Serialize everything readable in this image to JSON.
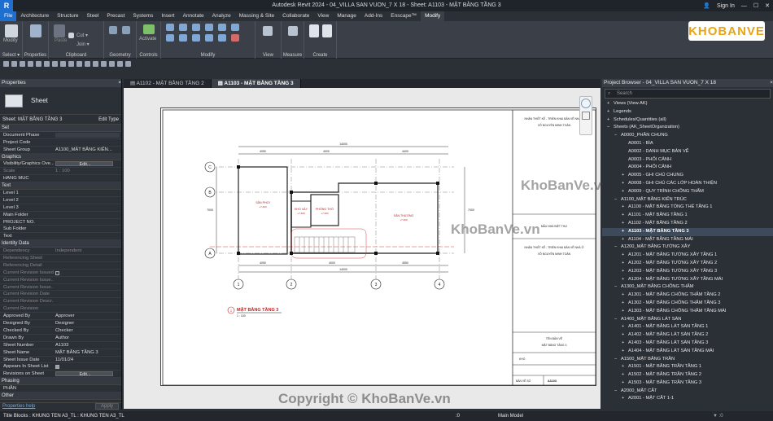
{
  "app": {
    "window_title": "Autodesk Revit 2024 - 04_VILLA SAN VUON_7 X 18 - Sheet: A1103 - MẶT BẰNG TẦNG 3",
    "logo": "R",
    "sign_in": "Sign In"
  },
  "menu": [
    "File",
    "Architecture",
    "Structure",
    "Steel",
    "Precast",
    "Systems",
    "Insert",
    "Annotate",
    "Analyze",
    "Massing & Site",
    "Collaborate",
    "View",
    "Manage",
    "Add-Ins",
    "Enscape™",
    "Modify"
  ],
  "ribbon": {
    "modify": "Modify",
    "select": "Select ▾",
    "properties": "Properties",
    "paste": "Paste",
    "cut": "Cut ▾",
    "join": "Join ▾",
    "clipboard": "Clipboard",
    "geometry": "Geometry",
    "activate": "Activate",
    "controls": "Controls",
    "modify_group": "Modify",
    "view": "View",
    "measure": "Measure",
    "create": "Create"
  },
  "watermark": {
    "logo": "KHOBANVE",
    "text1": "KhoBanVe.vn",
    "text2": "KhoBanVe.vn",
    "copyright": "Copyright © KhoBanVe.vn"
  },
  "properties": {
    "title": "Properties",
    "close": "×",
    "type": "Sheet",
    "selector": "Sheet: MẶT BẰNG TẦNG 3",
    "edit_type": "Edit Type",
    "rows": [
      {
        "cat": "Set"
      },
      {
        "k": "Document Phase",
        "box": true
      },
      {
        "k": "Project Code",
        "v": ""
      },
      {
        "k": "Sheet Group",
        "v": "A1100_MẶT BẰNG KIẾN..."
      },
      {
        "cat": "Graphics"
      },
      {
        "k": "Visibility/Graphics Ove...",
        "btn": "Edit..."
      },
      {
        "k": "Scale",
        "v": "1 : 100",
        "dim": true
      },
      {
        "k": "HANG MUC",
        "v": ""
      },
      {
        "cat": "Text"
      },
      {
        "k": "Level 1",
        "v": ""
      },
      {
        "k": "Level 2",
        "v": ""
      },
      {
        "k": "Level 3",
        "v": ""
      },
      {
        "k": "Main Folder",
        "v": ""
      },
      {
        "k": "PROJECT NO.",
        "v": ""
      },
      {
        "k": "Sub Folder",
        "v": ""
      },
      {
        "k": "Text",
        "v": ""
      },
      {
        "cat": "Identity Data"
      },
      {
        "k": "Dependency",
        "v": "Independent",
        "dim": true
      },
      {
        "k": "Referencing Sheet",
        "v": "",
        "dim": true
      },
      {
        "k": "Referencing Detail",
        "v": "",
        "dim": true
      },
      {
        "k": "Current Revision Issued",
        "cb": false,
        "dim": true
      },
      {
        "k": "Current Revision Issue...",
        "v": "",
        "dim": true
      },
      {
        "k": "Current Revision Issue...",
        "v": "",
        "dim": true
      },
      {
        "k": "Current Revision Date",
        "v": "",
        "dim": true
      },
      {
        "k": "Current Revision Descr...",
        "v": "",
        "dim": true
      },
      {
        "k": "Current Revision",
        "v": "",
        "dim": true
      },
      {
        "k": "Approved By",
        "v": "Approver"
      },
      {
        "k": "Designed By",
        "v": "Designer"
      },
      {
        "k": "Checked By",
        "v": "Checker"
      },
      {
        "k": "Drawn By",
        "v": "Author"
      },
      {
        "k": "Sheet Number",
        "v": "A1103"
      },
      {
        "k": "Sheet Name",
        "v": "MẶT BẰNG TẦNG 3"
      },
      {
        "k": "Sheet Issue Date",
        "v": "11/01/24"
      },
      {
        "k": "Appears In Sheet List",
        "cb": true
      },
      {
        "k": "Revisions on Sheet",
        "btn": "Edit..."
      },
      {
        "cat": "Phasing"
      },
      {
        "k": "PHẦN",
        "v": ""
      },
      {
        "cat": "Other"
      }
    ],
    "help": "Properties help",
    "apply": "Apply"
  },
  "tabs": [
    {
      "label": "A1102 - MẶT BẰNG TẦNG 2",
      "active": false
    },
    {
      "label": "A1103 - MẶT BẰNG TẦNG 3",
      "active": true
    }
  ],
  "drawing": {
    "dim_total": "14000",
    "dims_top": [
      "4050",
      "4000",
      "4400"
    ],
    "dims_bottom": [
      "4050",
      "4000",
      "4550"
    ],
    "side_dim": "7000",
    "rooms": [
      "SÂN PHƠI",
      "KHO XẢY",
      "PHÒNG THỜ",
      "SÂN THƯỢNG"
    ],
    "room_level": "+7.400",
    "grid_cols": [
      "1",
      "2",
      "3",
      "4"
    ],
    "grid_rows": [
      "C",
      "B",
      "A"
    ],
    "view_number": "1",
    "view_title": "MẶT BẰNG TẦNG 3",
    "view_scale": "1 : 100",
    "tb_company": "NHẬN THIẾT KẾ - TRIỂN KHAI BẢN VẼ NHÀ Ở",
    "tb_person": "VÕ NGUYÊN MINH TOÀN",
    "tb_project": "MẪU NHÀ BIỆT THỰ",
    "tb_sheet_label": "TÊN BẢN VẼ",
    "tb_sheet_name": "MẶT BẰNG TẦNG 3",
    "tb_scale": "KHỔ",
    "tb_no_label": "BẢN VẼ SỐ",
    "tb_no": "A1103"
  },
  "browser": {
    "title": "Project Browser - 04_VILLA SAN VUON_7 X 18",
    "close": "×",
    "search": "Search",
    "items": [
      {
        "t": "Views (View AK)",
        "l": 0,
        "exp": "+"
      },
      {
        "t": "Legends",
        "l": 0,
        "exp": "+"
      },
      {
        "t": "Schedules/Quantities (all)",
        "l": 0,
        "exp": "+"
      },
      {
        "t": "Sheets (AK_SheetOrganization)",
        "l": 0,
        "exp": "−"
      },
      {
        "t": "A0000_PHẦN CHUNG",
        "l": 1,
        "exp": "−"
      },
      {
        "t": "A0001 - BÌA",
        "l": 2
      },
      {
        "t": "A0002 - DANH MỤC BẢN VẼ",
        "l": 2
      },
      {
        "t": "A0003 - PHỐI CẢNH",
        "l": 2
      },
      {
        "t": "A0004 - PHỐI CẢNH",
        "l": 2
      },
      {
        "t": "A0005 - GHI CHÚ CHUNG",
        "l": 2,
        "exp": "+"
      },
      {
        "t": "A0008 - GHI CHÚ CÁC LỚP HOÀN THIỆN",
        "l": 2,
        "exp": "+"
      },
      {
        "t": "A0009 - QUY TRÌNH CHỐNG THẤM",
        "l": 2,
        "exp": "+"
      },
      {
        "t": "A1100_MẶT BẰNG KIẾN TRÚC",
        "l": 1,
        "exp": "−"
      },
      {
        "t": "A1100 - MẶT BẰNG TỔNG THỂ TẦNG 1",
        "l": 2,
        "exp": "+"
      },
      {
        "t": "A1101 - MẶT BẰNG TẦNG 1",
        "l": 2,
        "exp": "+"
      },
      {
        "t": "A1102 - MẶT BẰNG TẦNG 2",
        "l": 2,
        "exp": "+"
      },
      {
        "t": "A1103 - MẶT BẰNG TẦNG 3",
        "l": 2,
        "exp": "+",
        "sel": true
      },
      {
        "t": "A1104 - MẶT BẰNG TẦNG MÁI",
        "l": 2,
        "exp": "+"
      },
      {
        "t": "A1200_MẶT BẰNG TƯỜNG XÂY",
        "l": 1,
        "exp": "−"
      },
      {
        "t": "A1201 - MẶT BẰNG TƯỜNG XÂY TẦNG 1",
        "l": 2,
        "exp": "+"
      },
      {
        "t": "A1202 - MẶT BẰNG TƯỜNG XÂY TẦNG 2",
        "l": 2,
        "exp": "+"
      },
      {
        "t": "A1203 - MẶT BẰNG TƯỜNG XÂY TẦNG 3",
        "l": 2,
        "exp": "+"
      },
      {
        "t": "A1204 - MẶT BẰNG TƯỜNG XÂY TẦNG MÁI",
        "l": 2,
        "exp": "+"
      },
      {
        "t": "A1300_MẶT BẰNG CHỐNG THẤM",
        "l": 1,
        "exp": "−"
      },
      {
        "t": "A1301 - MẶT BẰNG CHỐNG THẤM TẦNG 2",
        "l": 2,
        "exp": "+"
      },
      {
        "t": "A1302 - MẶT BẰNG CHỐNG THẤM TẦNG 3",
        "l": 2,
        "exp": "+"
      },
      {
        "t": "A1303 - MẶT BẰNG CHỐNG THẤM TẦNG MÁI",
        "l": 2,
        "exp": "+"
      },
      {
        "t": "A1400_MẶT BẰNG LÁT SÀN",
        "l": 1,
        "exp": "−"
      },
      {
        "t": "A1401 - MẶT BẰNG LÁT SÀN TẦNG 1",
        "l": 2,
        "exp": "+"
      },
      {
        "t": "A1402 - MẶT BẰNG LÁT SÀN TẦNG 2",
        "l": 2,
        "exp": "+"
      },
      {
        "t": "A1403 - MẶT BẰNG LÁT SÀN TẦNG 3",
        "l": 2,
        "exp": "+"
      },
      {
        "t": "A1404 - MẶT BẰNG LÁT SÀN TẦNG MÁI",
        "l": 2,
        "exp": "+"
      },
      {
        "t": "A1500_MẶT BẰNG TRẦN",
        "l": 1,
        "exp": "−"
      },
      {
        "t": "A1501 - MẶT BẰNG TRẦN TẦNG 1",
        "l": 2,
        "exp": "+"
      },
      {
        "t": "A1502 - MẶT BẰNG TRẦN TẦNG 2",
        "l": 2,
        "exp": "+"
      },
      {
        "t": "A1503 - MẶT BẰNG TRẦN TẦNG 3",
        "l": 2,
        "exp": "+"
      },
      {
        "t": "A2000_MẶT CẮT",
        "l": 1,
        "exp": "−"
      },
      {
        "t": "A2001 - MẶT CẮT 1-1",
        "l": 2,
        "exp": "+"
      }
    ]
  },
  "status": {
    "left": "Title Blocks : KHUNG TEN A3_TL : KHUNG TEN A3_TL",
    "scale": ":0",
    "model": "Main Model"
  },
  "colors": {
    "accent": "#1f6fd1",
    "bg": "#2b2f36",
    "ribbon": "#3b4048",
    "wall": "#222222",
    "grid_red": "#d04040"
  }
}
